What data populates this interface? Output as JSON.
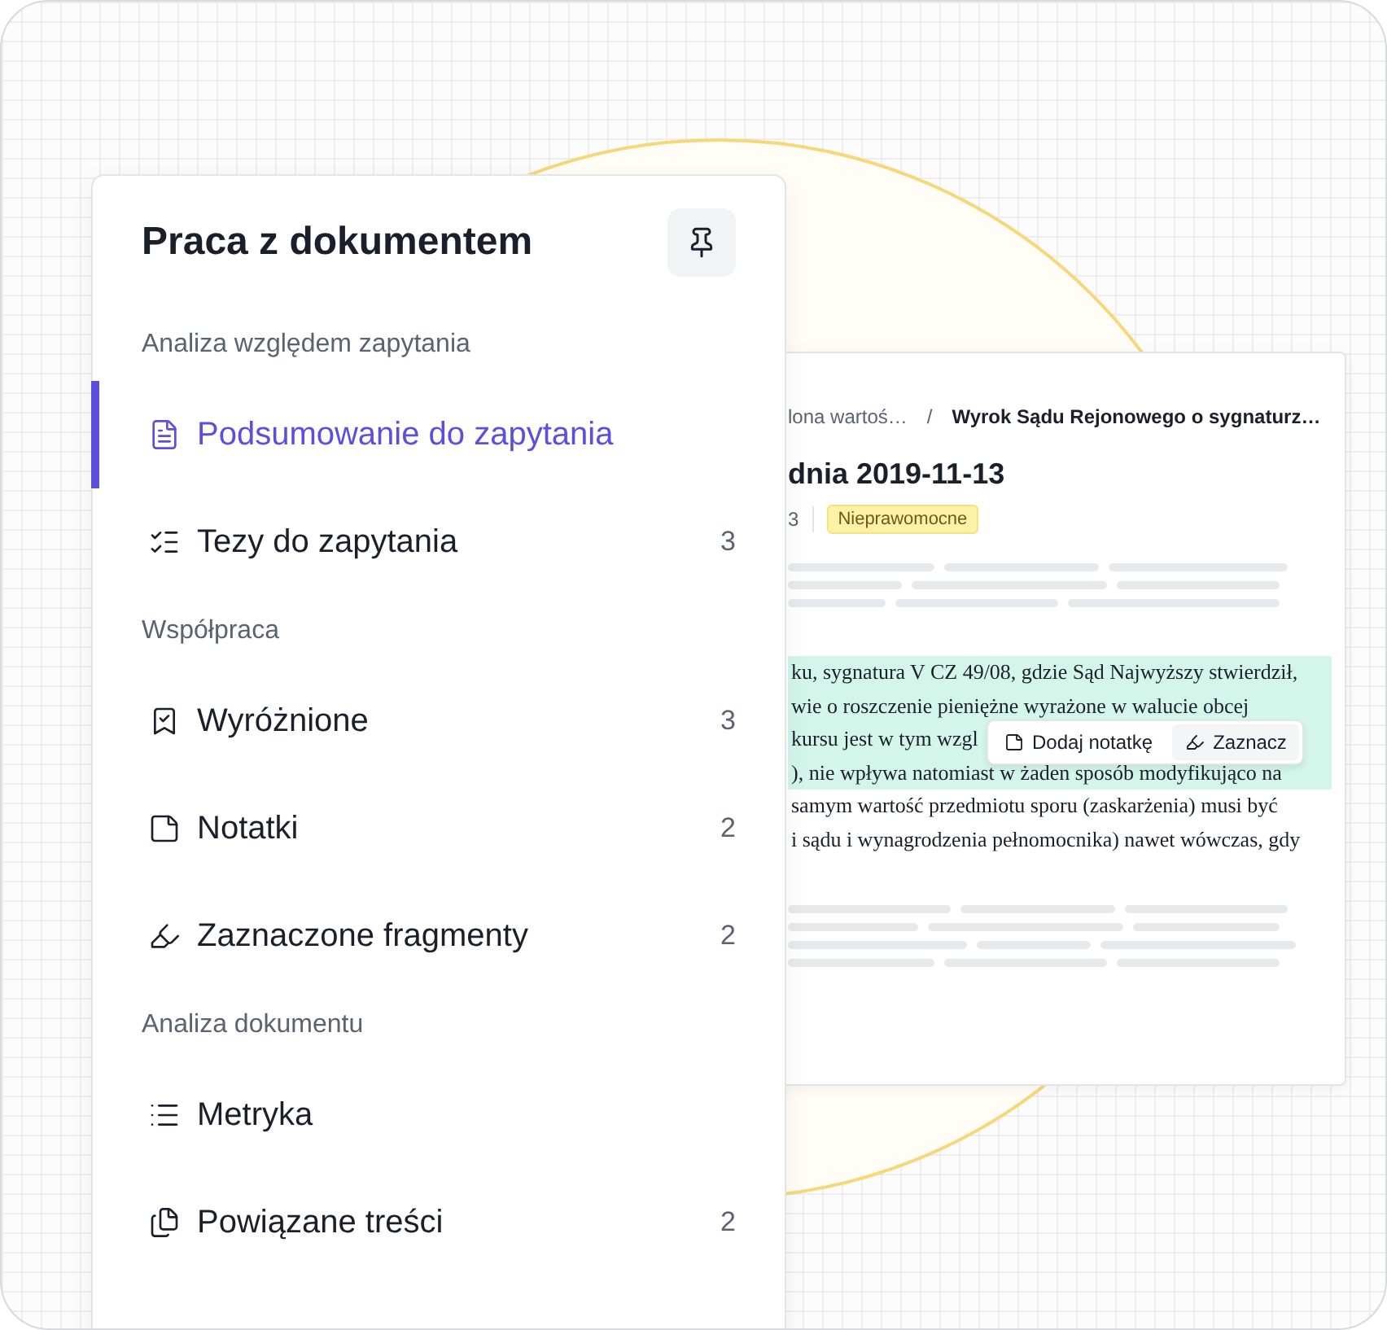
{
  "sidebar": {
    "title": "Praca z dokumentem",
    "sections": [
      {
        "label": "Analiza względem zapytania",
        "items": [
          {
            "label": "Podsumowanie do zapytania",
            "selected": true
          },
          {
            "label": "Tezy do zapytania",
            "count": "3",
            "selected": false
          }
        ]
      },
      {
        "label": "Współpraca",
        "items": [
          {
            "label": "Wyróżnione",
            "count": "3",
            "selected": false
          },
          {
            "label": "Notatki",
            "count": "2",
            "selected": false
          },
          {
            "label": "Zaznaczone fragmenty",
            "count": "2",
            "selected": false
          }
        ]
      },
      {
        "label": "Analiza dokumentu",
        "items": [
          {
            "label": "Metryka",
            "selected": false
          },
          {
            "label": "Powiązane treści",
            "count": "2",
            "selected": false
          }
        ]
      }
    ]
  },
  "document": {
    "breadcrumb": [
      "lona wartoś…",
      "Wyrok Sądu Rejonowego o sygnaturz…"
    ],
    "breadcrumb_separator": "/",
    "title": "dnia 2019-11-13",
    "meta": "3",
    "status_badge": "Nieprawomocne",
    "paragraph_lines": [
      {
        "text": "ku, sygnatura V CZ 49/08, gdzie Sąd Najwyższy stwierdził,",
        "highlighted": true
      },
      {
        "text": "wie o roszczenie pieniężne wyrażone w walucie obcej",
        "highlighted": true
      },
      {
        "text": "kursu jest w tym wzgl",
        "highlighted": true
      },
      {
        "text": "), nie wpływa natomiast w żaden sposób modyfikująco na",
        "highlighted": true
      },
      {
        "text": "samym wartość przedmiotu sporu (zaskarżenia) musi być",
        "highlighted": false
      },
      {
        "text": "i sądu i wynagrodzenia pełnomocnika) nawet wówczas, gdy",
        "highlighted": false
      }
    ],
    "selection_popup": {
      "buttons": [
        "Dodaj notatkę",
        "Zaznacz"
      ]
    }
  }
}
